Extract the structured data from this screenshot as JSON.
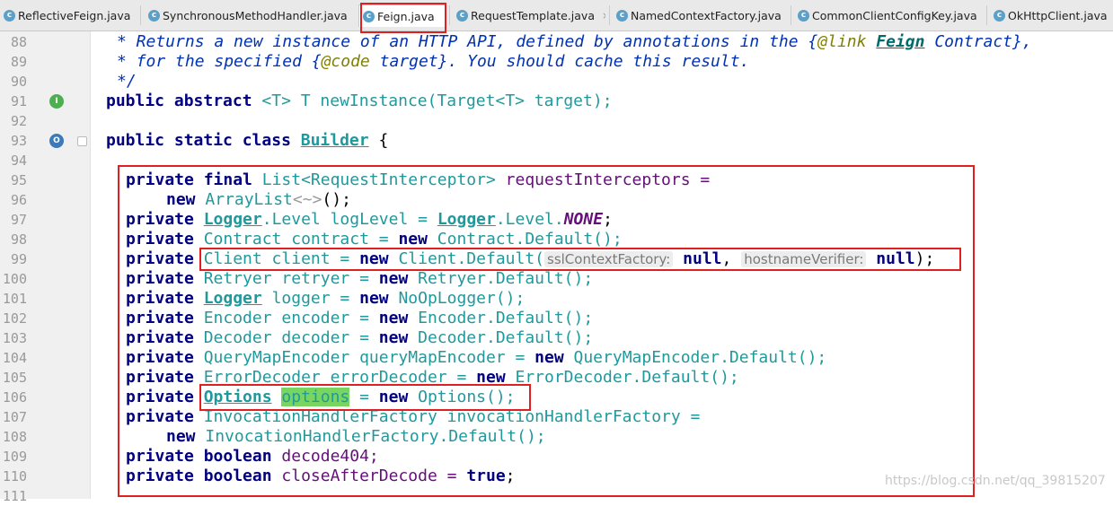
{
  "tabs": [
    {
      "label": "ReflectiveFeign.java"
    },
    {
      "label": "SynchronousMethodHandler.java"
    },
    {
      "label": "Feign.java"
    },
    {
      "label": "RequestTemplate.java"
    },
    {
      "label": "NamedContextFactory.java"
    },
    {
      "label": "CommonClientConfigKey.java"
    },
    {
      "label": "OkHttpClient.java"
    }
  ],
  "tab_icon_letter": "c",
  "close_glyph": "×",
  "line_numbers": [
    "88",
    "89",
    "90",
    "91",
    "92",
    "93",
    "94",
    "95",
    "96",
    "97",
    "98",
    "99",
    "100",
    "101",
    "102",
    "103",
    "104",
    "105",
    "106",
    "107",
    "108",
    "109",
    "110",
    "111"
  ],
  "code": {
    "l88": {
      "a": "* Returns a new instance of an HTTP API, defined by annotations in the {",
      "tag": "@link",
      "sp": " ",
      "link": "Feign",
      "b": " Contract},"
    },
    "l89": {
      "a": "* for the specified {",
      "tag": "@code",
      "b": " target}. You should cache this result."
    },
    "l90": {
      "a": "*/"
    },
    "l91": {
      "kw": "public abstract",
      "rest": " <T> T newInstance(Target<T> target);"
    },
    "l93": {
      "kw": "public static class",
      "sp": " ",
      "name": "Builder",
      "rest": " {"
    },
    "l95": {
      "kw1": "private final",
      "ty": " List<RequestInterceptor>",
      "rest": " requestInterceptors ="
    },
    "l96": {
      "kw": "new",
      "rest": " ArrayList",
      "dim": "<~>",
      "end": "();"
    },
    "l97": {
      "kw": "private",
      "sp": " ",
      "ul1": "Logger",
      "a": ".Level logLevel = ",
      "ul2": "Logger",
      "b": ".Level.",
      "en": "NONE",
      "end": ";"
    },
    "l98": {
      "kw": "private",
      "rest": " Contract contract = ",
      "kw2": "new",
      "end": " Contract.Default();"
    },
    "l99": {
      "kw": "private",
      "a": " Client client = ",
      "kw2": "new",
      "b": " Client.Default(",
      "hint1": "sslContextFactory:",
      "n1": "null",
      "c": ", ",
      "hint2": "hostnameVerifier:",
      "n2": "null",
      "end": ");"
    },
    "l100": {
      "kw": "private",
      "a": " Retryer retryer = ",
      "kw2": "new",
      "end": " Retryer.Default();"
    },
    "l101": {
      "kw": "private",
      "sp": " ",
      "ul": "Logger",
      "a": " logger = ",
      "kw2": "new",
      "end": " NoOpLogger();"
    },
    "l102": {
      "kw": "private",
      "a": " Encoder encoder = ",
      "kw2": "new",
      "end": " Encoder.Default();"
    },
    "l103": {
      "kw": "private",
      "a": " Decoder decoder = ",
      "kw2": "new",
      "end": " Decoder.Default();"
    },
    "l104": {
      "kw": "private",
      "a": " QueryMapEncoder queryMapEncoder = ",
      "kw2": "new",
      "end": " QueryMapEncoder.Default();"
    },
    "l105": {
      "kw": "private",
      "a": " ErrorDecoder errorDecoder = ",
      "kw2": "new",
      "end": " ErrorDecoder.Default();"
    },
    "l106": {
      "kw": "private",
      "sp": " ",
      "ul": "Options",
      "sp2": " ",
      "hl": "options",
      "a": " = ",
      "kw2": "new",
      "end": " Options();"
    },
    "l107": {
      "kw": "private",
      "rest": " InvocationHandlerFactory invocationHandlerFactory ="
    },
    "l108": {
      "kw": "new",
      "rest": " InvocationHandlerFactory.Default();"
    },
    "l109": {
      "kw": "private boolean",
      "rest": " decode404;"
    },
    "l110": {
      "kw": "private boolean",
      "a": " closeAfterDecode = ",
      "kw2": "true",
      "end": ";"
    }
  },
  "gutter_icons": {
    "l91": "I",
    "l93": "O"
  },
  "colors": {
    "highlight_box": "#e02020",
    "keyword": "#000080",
    "comment": "#0033b3",
    "search_highlight": "#78d660"
  },
  "watermark": "https://blog.csdn.net/qq_39815207"
}
